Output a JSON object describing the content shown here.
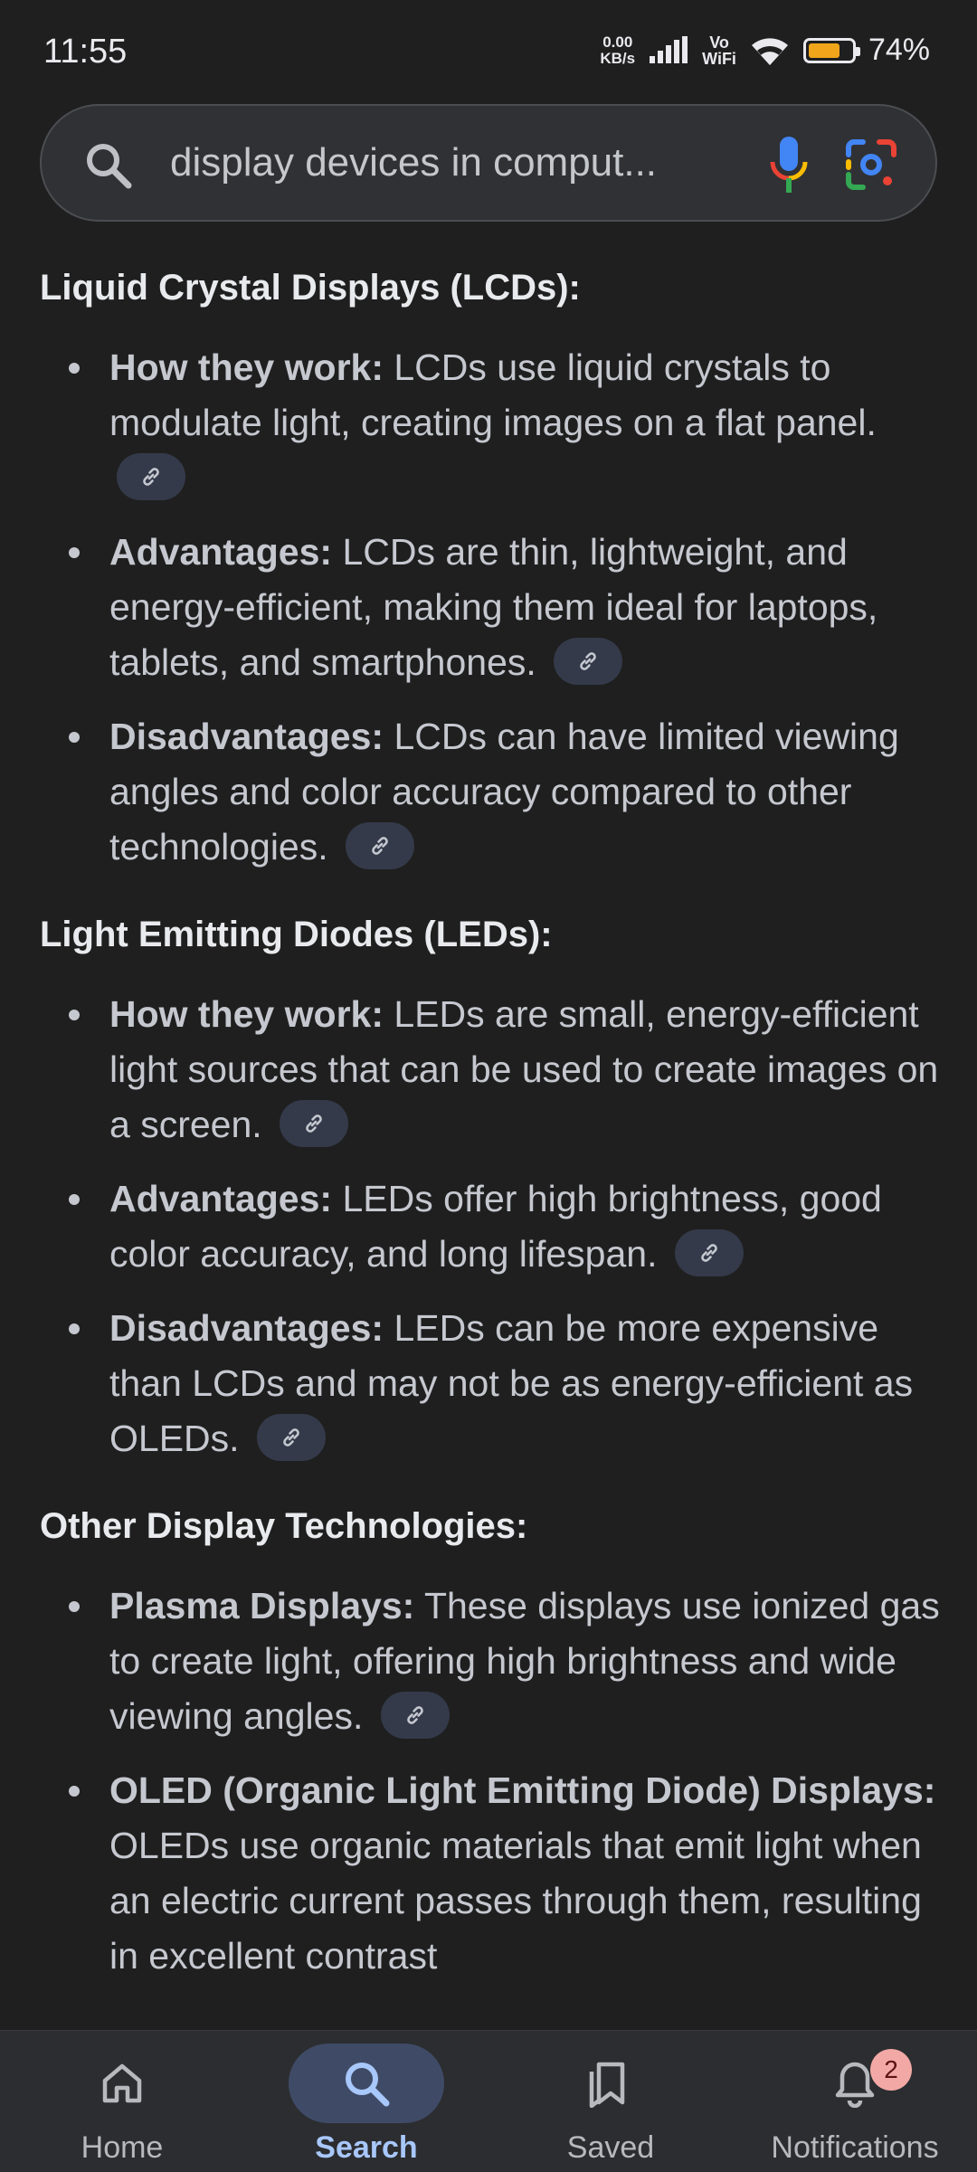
{
  "status": {
    "time": "11:55",
    "net_speed_value": "0.00",
    "net_speed_unit": "KB/s",
    "volte_top": "Vo",
    "volte_bottom": "WiFi",
    "battery_percent": "74%",
    "battery_level": 0.74,
    "battery_color": "#f0a51a"
  },
  "search": {
    "query": "display devices in comput..."
  },
  "sections": [
    {
      "title": "Liquid Crystal Displays (LCDs):",
      "items": [
        {
          "label": "How they work:",
          "text": " LCDs use liquid crystals to modulate light, creating images on a flat panel."
        },
        {
          "label": "Advantages:",
          "text": " LCDs are thin, lightweight, and energy-efficient, making them ideal for laptops, tablets, and smartphones."
        },
        {
          "label": "Disadvantages:",
          "text": " LCDs can have limited viewing angles and color accuracy compared to other technologies."
        }
      ]
    },
    {
      "title": "Light Emitting Diodes (LEDs):",
      "items": [
        {
          "label": "How they work:",
          "text": " LEDs are small, energy-efficient light sources that can be used to create images on a screen."
        },
        {
          "label": "Advantages:",
          "text": " LEDs offer high brightness, good color accuracy, and long lifespan."
        },
        {
          "label": "Disadvantages:",
          "text": " LEDs can be more expensive than LCDs and may not be as energy-efficient as OLEDs."
        }
      ]
    },
    {
      "title": "Other Display Technologies:",
      "items": [
        {
          "label": "Plasma Displays:",
          "text": " These displays use ionized gas to create light, offering high brightness and wide viewing angles."
        },
        {
          "label": "OLED (Organic Light Emitting Diode) Displays:",
          "text": " OLEDs use organic materials that emit light when an electric current passes through them, resulting in excellent contrast"
        }
      ]
    }
  ],
  "nav": {
    "home": "Home",
    "search": "Search",
    "saved": "Saved",
    "notifications": "Notifications",
    "notifications_badge": "2"
  },
  "icons": {
    "link": "link-icon",
    "home": "home-icon",
    "search": "search-icon",
    "saved": "bookmarks-icon",
    "notifications": "bell-icon"
  },
  "colors": {
    "accent": "#a8c7fa",
    "active_pill": "#3f4b66",
    "badge": "#f2a9a6"
  }
}
